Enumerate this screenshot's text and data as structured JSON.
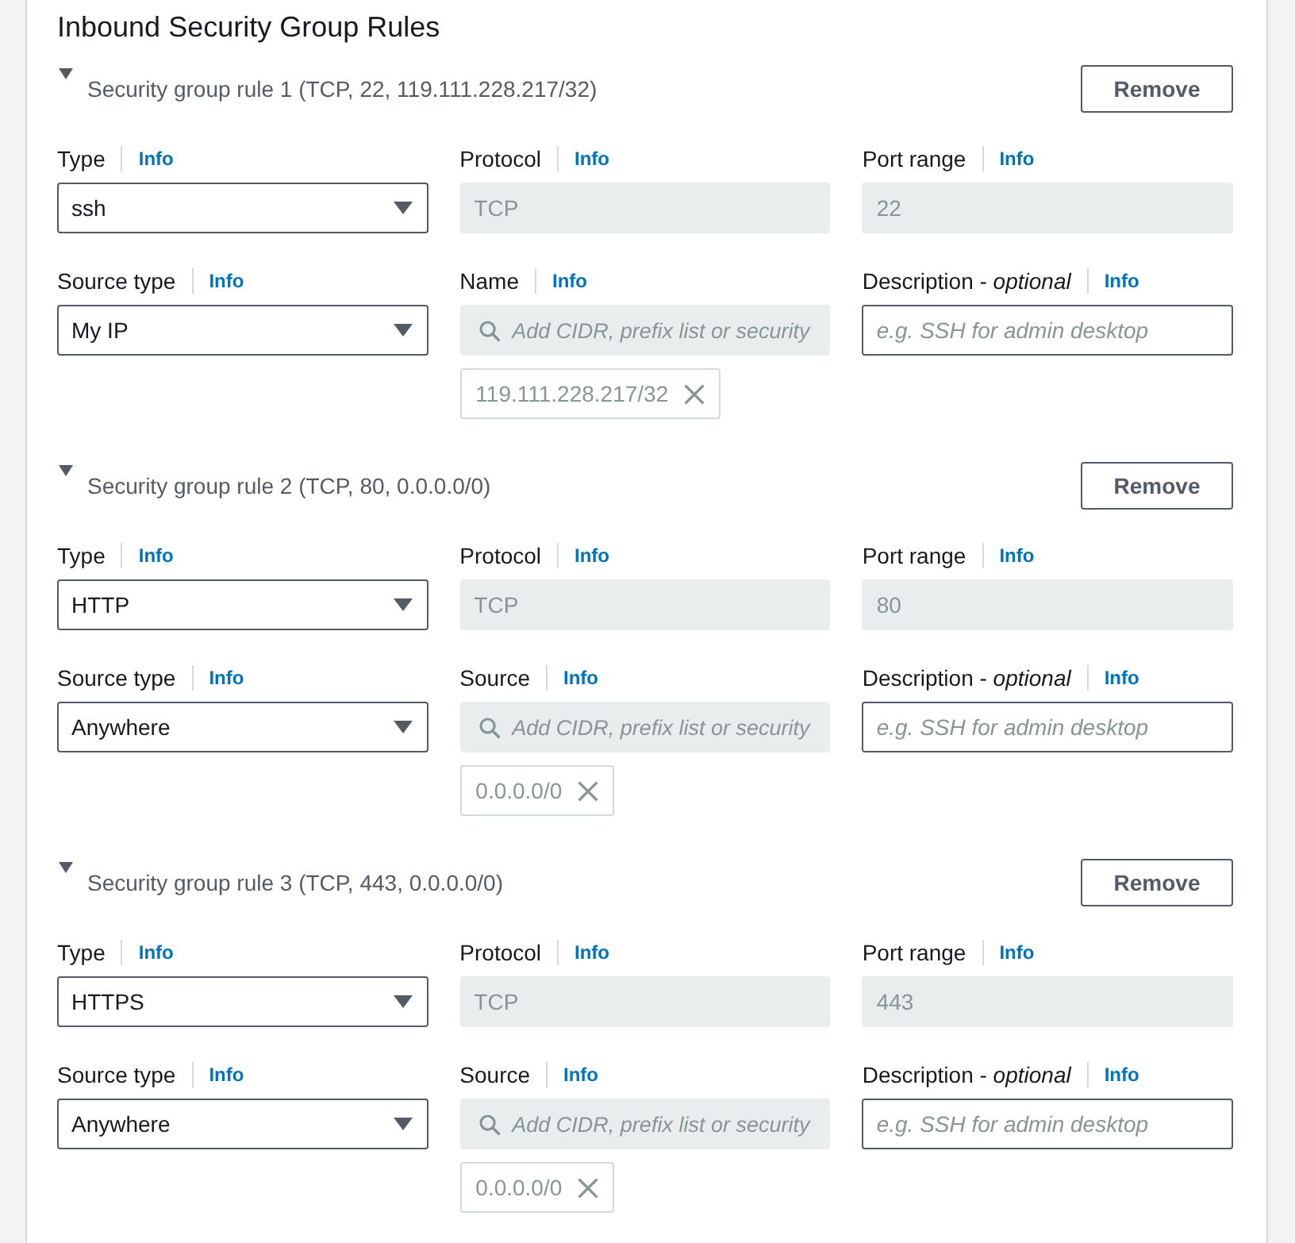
{
  "section": {
    "title": "Inbound Security Group Rules"
  },
  "rules": [
    {
      "title": "Security group rule 1 (TCP, 22, 119.111.228.217/32)",
      "expanded": true,
      "remove": "Remove",
      "fields": [
        {
          "kind": "select",
          "label": "Type",
          "info": "Info",
          "value": "ssh"
        },
        {
          "kind": "text",
          "label": "Protocol",
          "info": "Info",
          "value": "TCP",
          "disabled": true
        },
        {
          "kind": "text",
          "label": "Port range",
          "info": "Info",
          "value": "22",
          "disabled": true
        },
        {
          "kind": "select",
          "label": "Source type",
          "info": "Info",
          "value": "My IP"
        },
        {
          "kind": "search",
          "label": "Name",
          "info": "Info",
          "placeholder": "Add CIDR, prefix list or security",
          "disabled": true,
          "tokens": [
            {
              "label": "119.111.228.217/32"
            }
          ]
        },
        {
          "kind": "text",
          "label": "Description - *optional*",
          "info": "Info",
          "placeholder": "e.g. SSH for admin desktop",
          "disabled": false
        }
      ]
    },
    {
      "title": "Security group rule 2 (TCP, 80, 0.0.0.0/0)",
      "expanded": true,
      "remove": "Remove",
      "fields": [
        {
          "kind": "select",
          "label": "Type",
          "info": "Info",
          "value": "HTTP"
        },
        {
          "kind": "text",
          "label": "Protocol",
          "info": "Info",
          "value": "TCP",
          "disabled": true
        },
        {
          "kind": "text",
          "label": "Port range",
          "info": "Info",
          "value": "80",
          "disabled": true
        },
        {
          "kind": "select",
          "label": "Source type",
          "info": "Info",
          "value": "Anywhere"
        },
        {
          "kind": "search",
          "label": "Source",
          "info": "Info",
          "placeholder": "Add CIDR, prefix list or security",
          "disabled": true,
          "tokens": [
            {
              "label": "0.0.0.0/0"
            }
          ]
        },
        {
          "kind": "text",
          "label": "Description - *optional*",
          "info": "Info",
          "placeholder": "e.g. SSH for admin desktop",
          "disabled": false
        }
      ]
    },
    {
      "title": "Security group rule 3 (TCP, 443, 0.0.0.0/0)",
      "expanded": true,
      "remove": "Remove",
      "fields": [
        {
          "kind": "select",
          "label": "Type",
          "info": "Info",
          "value": "HTTPS"
        },
        {
          "kind": "text",
          "label": "Protocol",
          "info": "Info",
          "value": "TCP",
          "disabled": true
        },
        {
          "kind": "text",
          "label": "Port range",
          "info": "Info",
          "value": "443",
          "disabled": true
        },
        {
          "kind": "select",
          "label": "Source type",
          "info": "Info",
          "value": "Anywhere"
        },
        {
          "kind": "search",
          "label": "Source",
          "info": "Info",
          "placeholder": "Add CIDR, prefix list or security",
          "disabled": true,
          "tokens": [
            {
              "label": "0.0.0.0/0"
            }
          ]
        },
        {
          "kind": "text",
          "label": "Description - *optional*",
          "info": "Info",
          "placeholder": "e.g. SSH for admin desktop",
          "disabled": false
        }
      ]
    }
  ]
}
